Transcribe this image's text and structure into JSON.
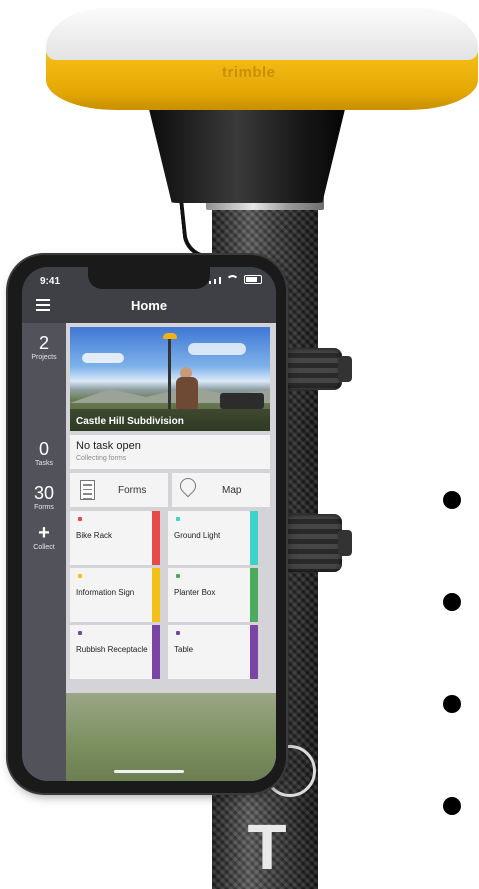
{
  "receiver": {
    "brand_logo": "trimble"
  },
  "phone": {
    "status_bar": {
      "time": "9:41"
    },
    "header": {
      "title": "Home",
      "menu_icon": "hamburger-menu-icon"
    },
    "sidebar": {
      "projects": {
        "count": "2",
        "label": "Projects"
      },
      "tasks": {
        "count": "0",
        "label": "Tasks"
      },
      "forms": {
        "count": "30",
        "label": "Forms"
      },
      "collect": {
        "symbol": "+",
        "label": "Collect"
      }
    },
    "project_card": {
      "name": "Castle Hill Subdivision"
    },
    "task_card": {
      "title": "No task open",
      "subtitle": "Collecting forms"
    },
    "nav": {
      "forms_label": "Forms",
      "map_label": "Map"
    },
    "forms": [
      {
        "label": "Bike Rack",
        "color": "#e84a4a"
      },
      {
        "label": "Ground Light",
        "color": "#3ed2c9"
      },
      {
        "label": "Information Sign",
        "color": "#f2c019"
      },
      {
        "label": "Planter Box",
        "color": "#4caa5c"
      },
      {
        "label": "Rubbish Receptacle",
        "color": "#7a45a5"
      },
      {
        "label": "Table",
        "color": "#7a45a5"
      }
    ]
  },
  "colors": {
    "receiver_yellow": "#f6bf17",
    "app_dark": "#3f3f46"
  }
}
